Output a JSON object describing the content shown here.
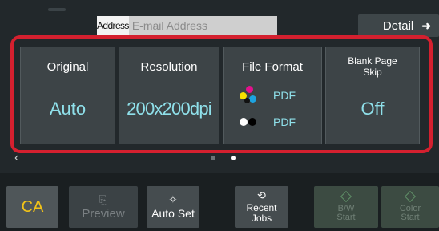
{
  "header": {
    "address_label": "Address",
    "address_placeholder": "E-mail Address",
    "detail_label": "Detail",
    "detail_icon": "arrow-right-icon"
  },
  "settings": [
    {
      "title": "Original",
      "value": "Auto"
    },
    {
      "title": "Resolution",
      "value": "200x200dpi"
    },
    {
      "title": "File Format",
      "color_value": "PDF",
      "bw_value": "PDF"
    },
    {
      "title": "Blank Page Skip",
      "value": "Off"
    }
  ],
  "pager": {
    "total": 2,
    "active": 2
  },
  "bottom": {
    "ca_label": "CA",
    "preview_label": "Preview",
    "autoset_label": "Auto Set",
    "recent_label_line1": "Recent",
    "recent_label_line2": "Jobs",
    "bw_label_line1": "B/W",
    "bw_label_line2": "Start",
    "color_label_line1": "Color",
    "color_label_line2": "Start"
  },
  "colors": {
    "highlight": "#d4202f",
    "value_text": "#8fe0ea",
    "ca_text": "#f2c318"
  }
}
